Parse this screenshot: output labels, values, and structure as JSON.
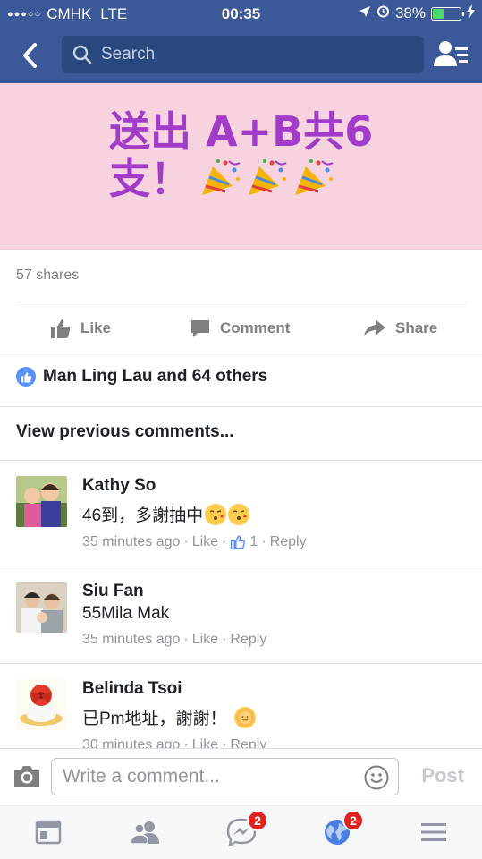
{
  "status_bar": {
    "carrier": "CMHK",
    "network": "LTE",
    "time": "00:35",
    "battery": "38%",
    "battery_level": 0.38
  },
  "nav": {
    "search_placeholder": "Search"
  },
  "post": {
    "image_text_line1": "送出 A+B共6",
    "image_text_line2": "支！",
    "shares": "57 shares",
    "actions": {
      "like": "Like",
      "comment": "Comment",
      "share": "Share"
    },
    "reactions_text": "Man Ling Lau and 64 others",
    "view_previous": "View previous comments..."
  },
  "comments": [
    {
      "name": "Kathy So",
      "text": "46到，多謝抽中",
      "time": "35 minutes ago",
      "like": "Like",
      "likes_count": "1",
      "reply": "Reply"
    },
    {
      "name": "Siu Fan",
      "text": "55Mila Mak",
      "time": "35 minutes ago",
      "like": "Like",
      "reply": "Reply"
    },
    {
      "name": "Belinda Tsoi",
      "text": "已Pm地址，謝謝！",
      "time": "30 minutes ago",
      "like": "Like",
      "reply": "Reply"
    }
  ],
  "composer": {
    "placeholder": "Write a comment...",
    "post_label": "Post"
  },
  "tabbar": {
    "messages_badge": "2",
    "notifications_badge": "2"
  },
  "colors": {
    "brand": "#3b5998",
    "banner_text": "#a13cc8",
    "banner_bg": "#f7d2df",
    "badge": "#e0221f"
  }
}
